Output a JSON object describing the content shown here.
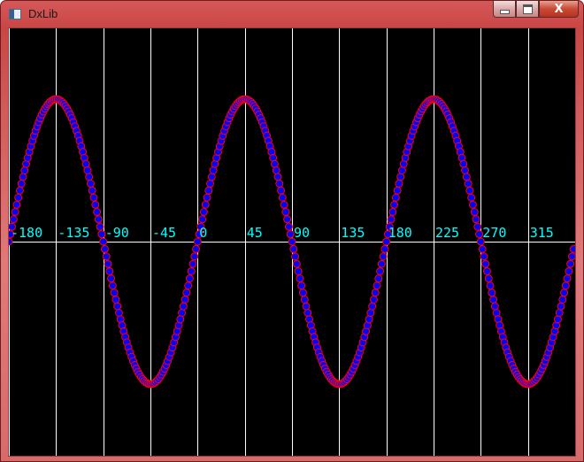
{
  "window": {
    "title": "DxLib",
    "close_glyph": "X",
    "icons": {
      "app": "window-app-icon",
      "minimize": "minimize-icon",
      "maximize": "maximize-icon",
      "close": "close-icon"
    }
  },
  "chart_data": {
    "type": "scatter",
    "x_tick_labels": [
      "-180",
      "-135",
      "-90",
      "-45",
      "0",
      "45",
      "90",
      "135",
      "180",
      "225",
      "270",
      "315"
    ],
    "x_ticks": [
      -180,
      -135,
      -90,
      -45,
      0,
      45,
      90,
      135,
      180,
      225,
      270,
      315
    ],
    "xlim": [
      -180,
      360
    ],
    "ylim": [
      -1,
      1
    ],
    "function": "sin(2x)",
    "series": [
      {
        "formula": "y = sin(2x)",
        "x_start": -180,
        "x_end": 359,
        "x_step": 1.5
      }
    ],
    "grid": true,
    "colors": {
      "background": "#000000",
      "grid": "#ffffff",
      "point_fill": "#0000ff",
      "point_stroke": "#ff0000",
      "tick_label": "#00ffff"
    }
  }
}
